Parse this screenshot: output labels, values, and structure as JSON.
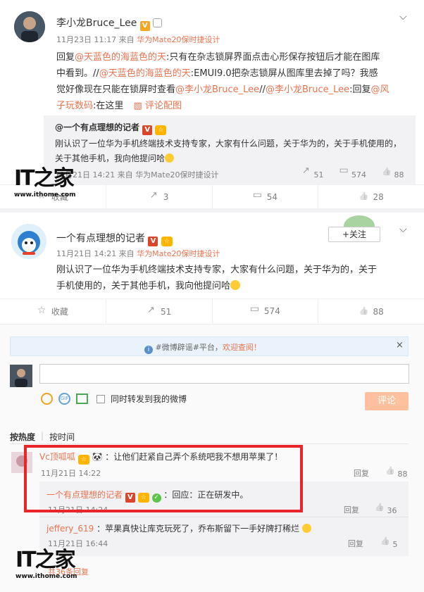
{
  "post1": {
    "username": "李小龙Bruce_Lee",
    "meta_time": "11月23日 11:17 来自",
    "meta_source": "华为Mate20保时捷设计",
    "body_line1_prefix": "回复",
    "body_mention1": "@天蓝色的海蓝色的天",
    "body_line1_text": ":只有在杂志锁屏界面点击心形保存按钮后才能在图库",
    "body_line2_text": "中看到。//",
    "body_mention2": "@天蓝色的海蓝色的天",
    "body_line2_rest": ":EMUI9.0把杂志锁屏从图库里去掉了吗？我感",
    "body_line3_text": "觉好像现在只能在锁屏时查看",
    "body_mention3": "@李小龙Bruce_Lee",
    "body_line3_sep": "//",
    "body_mention4": "@李小龙Bruce_Lee",
    "body_line3_reply": ":回复",
    "body_mention5_part1": "@风",
    "body_line4_mention5_part2": "子玩数码",
    "body_line4_text": ":在这里",
    "body_line4_link": "评论配图",
    "quote": {
      "author": "@一个有点理想的记者",
      "text_line1": "刚认识了一位华为手机终端技术支持专家，大家有什么问题，关于华为的，关于手机使用的，",
      "text_line2": "关于其他手机，我向他提问哈",
      "time": "11月21日 14:21 来自",
      "source": "华为Mate20保时捷设计",
      "share_count": "51",
      "comment_count": "574",
      "like_count": "88"
    },
    "actions": {
      "fav": "收藏",
      "share": "3",
      "comment": "54",
      "like": "28"
    }
  },
  "post2": {
    "username": "一个有点理想的记者",
    "follow_label": "+关注",
    "meta_time": "11月21日 14:21 来自",
    "meta_source": "华为Mate20保时捷设计",
    "body_line1": "刚认识了一位华为手机终端技术支持专家，大家有什么问题，关于华为的，关于",
    "body_line2": "手机使用的，关于其他手机，我向他提问哈",
    "actions": {
      "fav": "收藏",
      "share": "51",
      "comment": "574",
      "like": "88"
    }
  },
  "notice": {
    "prefix": "#微博辟谣#平台，",
    "link": "欢迎查阅！"
  },
  "composer": {
    "forward_label": "同时转发到我的微博",
    "submit_label": "评论"
  },
  "sort_tabs": {
    "hot": "按热度",
    "time": "按时间"
  },
  "comments": [
    {
      "user": "Vc顶呱呱",
      "text": "：让他们赶紧自己弄个系统吧我不想用苹果了！",
      "time": "11月21日 14:22",
      "reply_label": "回复",
      "like_count": "88"
    }
  ],
  "replies": [
    {
      "user": "一个有点理想的记者",
      "text": "：回应：正在研发中。",
      "time": "11月21日 14:24",
      "reply_label": "回复",
      "like_count": "36"
    },
    {
      "user": "jeffery_619",
      "text": "：苹果真快让库克玩死了，乔布斯留下一手好牌打稀烂",
      "time": "11月21日 16:44",
      "reply_label": "回复",
      "like_count": "5"
    }
  ],
  "more_replies": "共36条回复",
  "watermark": {
    "logo": "IT之家",
    "url": "www.ithome.com"
  }
}
